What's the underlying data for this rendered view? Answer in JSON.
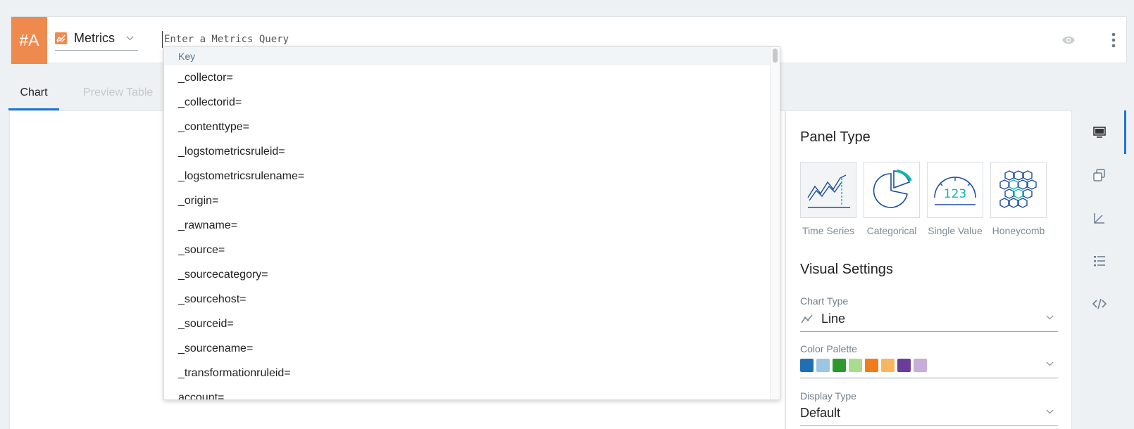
{
  "query_row": {
    "badge": "#A",
    "source_label": "Metrics",
    "query_placeholder": "Enter a Metrics Query"
  },
  "icons": {
    "source": "metrics-chart-icon",
    "eye": "eye-icon",
    "more": "more-vertical-icon"
  },
  "tabs": [
    {
      "label": "Chart",
      "active": true
    },
    {
      "label": "Preview Table",
      "active": false
    }
  ],
  "autocomplete": {
    "header": "Key",
    "items": [
      "_collector=",
      "_collectorid=",
      "_contenttype=",
      "_logstometricsruleid=",
      "_logstometricsrulename=",
      "_origin=",
      "_rawname=",
      "_source=",
      "_sourcecategory=",
      "_sourcehost=",
      "_sourceid=",
      "_sourcename=",
      "_transformationruleid=",
      "account="
    ]
  },
  "settings": {
    "panel_type_title": "Panel Type",
    "panel_types": [
      {
        "label": "Time Series",
        "icon": "time-series-icon",
        "selected": true
      },
      {
        "label": "Categorical",
        "icon": "pie-chart-icon",
        "selected": false
      },
      {
        "label": "Single Value",
        "icon": "gauge-icon",
        "selected": false
      },
      {
        "label": "Honeycomb",
        "icon": "honeycomb-icon",
        "selected": false
      }
    ],
    "visual_title": "Visual Settings",
    "chart_type_label": "Chart Type",
    "chart_type_value": "Line",
    "color_palette_label": "Color Palette",
    "palette_colors": [
      "#1f6fb4",
      "#9cc6e4",
      "#2e9a2e",
      "#a9dc8c",
      "#f27c1c",
      "#f9b65f",
      "#6a3d9a",
      "#c6aed8"
    ],
    "display_type_label": "Display Type",
    "display_type_value": "Default"
  },
  "side_rail": [
    "monitor-icon",
    "copy-icon",
    "axes-icon",
    "list-icon",
    "code-icon"
  ],
  "colors": {
    "accent": "#1a77d2",
    "badge": "#ef8a4e"
  }
}
